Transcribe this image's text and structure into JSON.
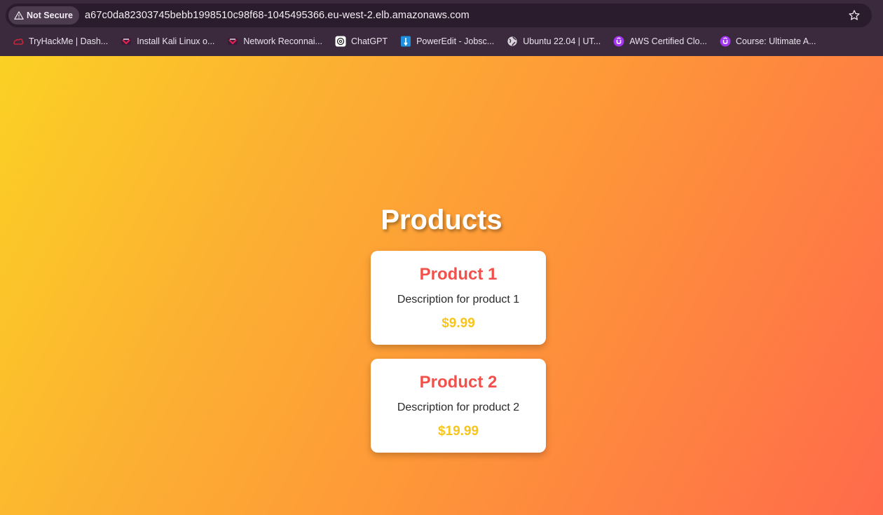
{
  "browser": {
    "security_label": "Not Secure",
    "url": "a67c0da82303745bebb1998510c98f68-1045495366.eu-west-2.elb.amazonaws.com",
    "bookmarks": [
      {
        "label": "TryHackMe | Dash...",
        "icon": "tryhackme-icon"
      },
      {
        "label": "Install Kali Linux o...",
        "icon": "kali-icon"
      },
      {
        "label": "Network Reconnai...",
        "icon": "kali-icon"
      },
      {
        "label": "ChatGPT",
        "icon": "chatgpt-icon"
      },
      {
        "label": "PowerEdit - Jobsc...",
        "icon": "poweredit-icon"
      },
      {
        "label": "Ubuntu 22.04 | UT...",
        "icon": "globe-icon"
      },
      {
        "label": "AWS Certified Clo...",
        "icon": "udemy-icon"
      },
      {
        "label": "Course: Ultimate A...",
        "icon": "udemy-icon"
      }
    ]
  },
  "page": {
    "title": "Products",
    "products": [
      {
        "name": "Product 1",
        "description": "Description for product 1",
        "price": "$9.99"
      },
      {
        "name": "Product 2",
        "description": "Description for product 2",
        "price": "$19.99"
      }
    ]
  },
  "colors": {
    "gradient_start": "#fbd124",
    "gradient_end": "#ff6a4b",
    "product_name": "#f2504b",
    "price": "#f7c51c",
    "card_background": "#ffffff"
  }
}
